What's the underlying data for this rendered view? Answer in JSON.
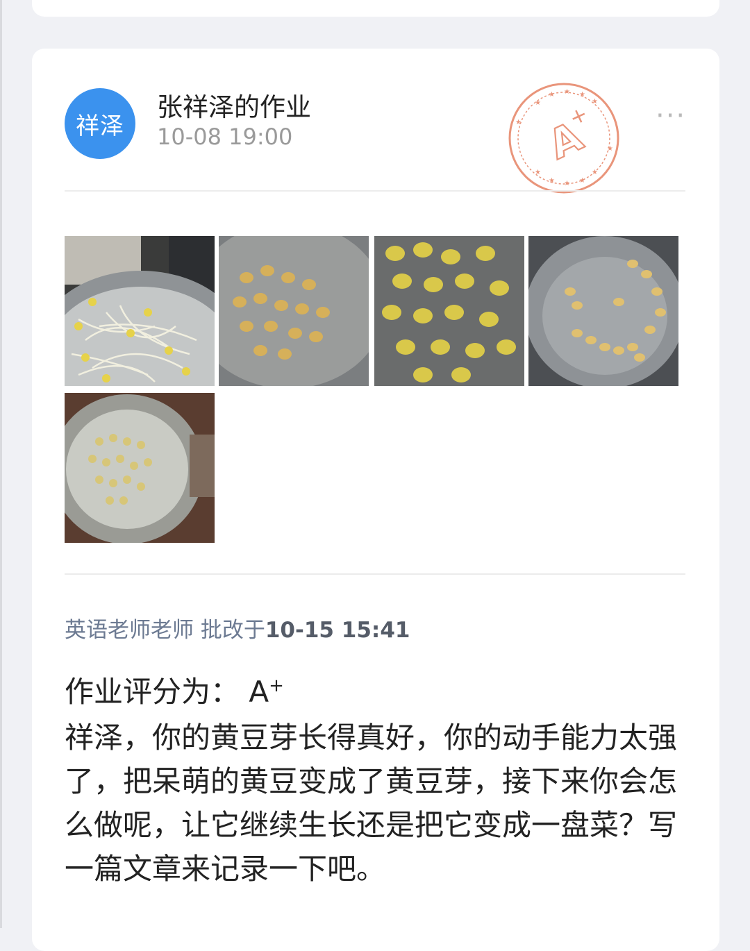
{
  "card": {
    "avatar_text": "祥泽",
    "title": "张祥泽的作业",
    "time": "10-08 19:00",
    "more_icon": "more-dots-icon",
    "stamp": {
      "grade": "A+",
      "color": "#e9957b"
    }
  },
  "photos": [
    {
      "name": "bean-sprouts-photo"
    },
    {
      "name": "soybeans-photo-1"
    },
    {
      "name": "soybeans-photo-2"
    },
    {
      "name": "soybeans-photo-3"
    },
    {
      "name": "soybeans-photo-4"
    }
  ],
  "review": {
    "teacher": "英语老师老师",
    "action": "批改于",
    "time": "10-15 15:41",
    "grade_label": "作业评分为：",
    "grade_value": "A",
    "grade_sup": "+",
    "comment": "祥泽，你的黄豆芽长得真好，你的动手能力太强了，把呆萌的黄豆变成了黄豆芽，接下来你会怎么做呢，让它继续生长还是把它变成一盘菜？写一篇文章来记录一下吧。"
  },
  "colors": {
    "avatar": "#3b92ee",
    "reviewer": "#6c7a92"
  }
}
